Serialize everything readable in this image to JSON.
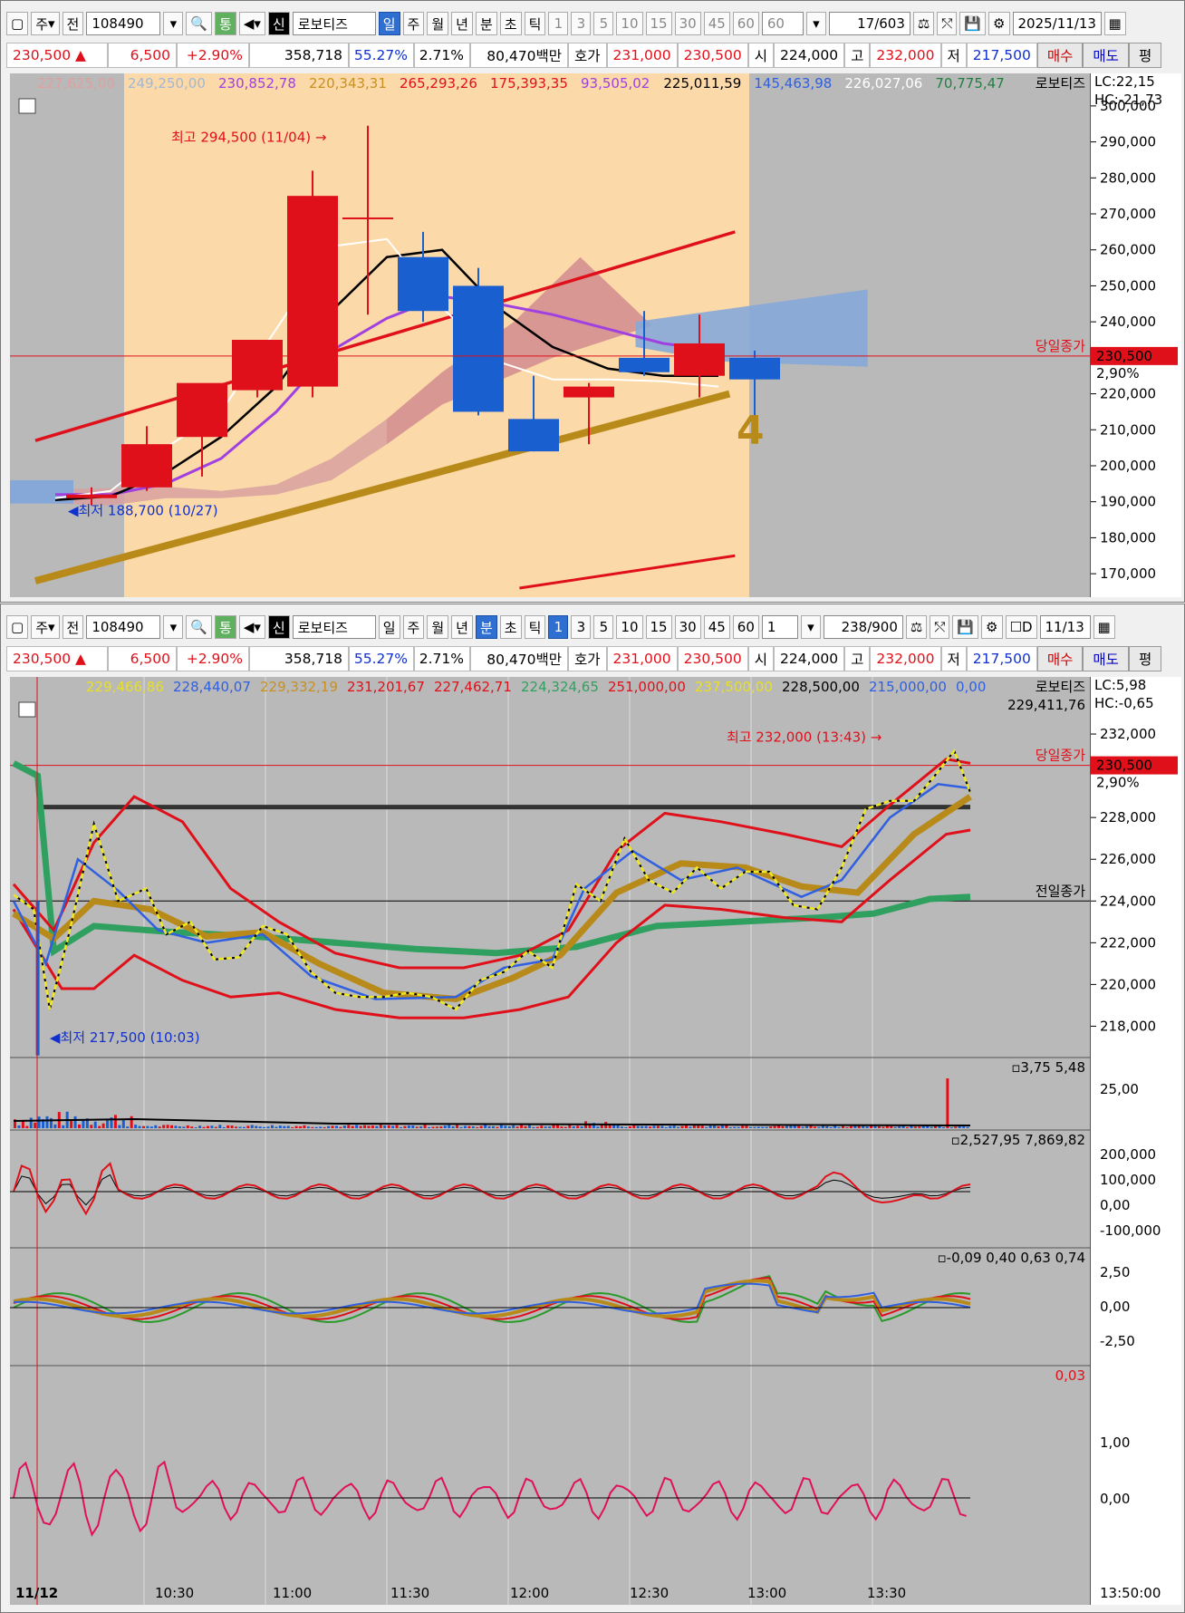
{
  "toolbar1": {
    "code": "108490",
    "name": "로보티즈",
    "btn_ju": "주",
    "btn_jeon": "전",
    "period_tabs": [
      "일",
      "주",
      "월",
      "년",
      "분",
      "초",
      "틱"
    ],
    "nums": [
      "1",
      "3",
      "5",
      "10",
      "15",
      "30",
      "45",
      "60",
      "60"
    ],
    "count": "17",
    "count_total": "/603",
    "date": "2025/11/13",
    "btn_tong": "통",
    "btn_sin": "신"
  },
  "toolbar2": {
    "code": "108490",
    "name": "로보티즈",
    "btn_ju": "주",
    "btn_jeon": "전",
    "period_tabs": [
      "일",
      "주",
      "월",
      "년",
      "분",
      "초",
      "틱"
    ],
    "nums": [
      "1",
      "3",
      "5",
      "10",
      "15",
      "30",
      "45",
      "60"
    ],
    "interval": "1",
    "count": "238",
    "count_total": "/900",
    "date": "11/13",
    "check_label": "D",
    "btn_tong": "통",
    "btn_sin": "신"
  },
  "quote": {
    "price": "230,500",
    "arrow": "▲",
    "change": "6,500",
    "pct": "+2.90%",
    "volume": "358,718",
    "ratio1": "55.27%",
    "ratio2": "2.71%",
    "amount": "80,470백만",
    "hoga_label": "호가",
    "ask": "231,000",
    "bid": "230,500",
    "open_label": "시",
    "open": "224,000",
    "high_label": "고",
    "high": "232,000",
    "low_label": "저",
    "low": "217,500",
    "buy": "매수",
    "sell": "매도",
    "eval": "평"
  },
  "colors": {
    "up": "#e0101a",
    "down": "#1a5fd0",
    "highlight": "#fcd9a8",
    "plot_bg": "#b9b9b9"
  },
  "chart_data": [
    {
      "type": "candlestick",
      "title": "daily",
      "legend_values": [
        "227,625,00",
        "249,250,00",
        "230,852,78",
        "220,343,31",
        "265,293,26",
        "175,393,35",
        "93,505,02",
        "225,011,59",
        "145,463,98",
        "226,027,06",
        "70,775,47"
      ],
      "legend_colors": [
        "#e0a0a0",
        "#a0b8d8",
        "#a040e0",
        "#c89020",
        "#e0101a",
        "#e0101a",
        "#a040e0",
        "#000000",
        "#3060e0",
        "#ffffff",
        "#208040"
      ],
      "legend_name": "로보티즈",
      "lc_label": "LC:22,15",
      "hc_label": "HC:-21,73",
      "ylim": [
        166000,
        304000
      ],
      "y_ticks": [
        "300,000",
        "290,000",
        "280,000",
        "270,000",
        "260,000",
        "250,000",
        "240,000",
        "230,000",
        "220,000",
        "210,000",
        "200,000",
        "190,000",
        "180,000",
        "170,000"
      ],
      "y_tick_values": [
        300000,
        290000,
        280000,
        270000,
        260000,
        250000,
        240000,
        230000,
        220000,
        210000,
        200000,
        190000,
        180000,
        170000
      ],
      "candles": [
        {
          "o": 191000,
          "h": 194000,
          "l": 189000,
          "c": 192000
        },
        {
          "o": 194000,
          "h": 211000,
          "l": 193000,
          "c": 206000
        },
        {
          "o": 208000,
          "h": 222000,
          "l": 197000,
          "c": 223000
        },
        {
          "o": 221000,
          "h": 234000,
          "l": 219000,
          "c": 235000
        },
        {
          "o": 222000,
          "h": 282000,
          "l": 219000,
          "c": 275000
        },
        {
          "o": 269000,
          "h": 294500,
          "l": 242000,
          "c": 269000
        },
        {
          "o": 258000,
          "h": 265000,
          "l": 240000,
          "c": 243000
        },
        {
          "o": 250000,
          "h": 255000,
          "l": 214000,
          "c": 215000
        },
        {
          "o": 213000,
          "h": 225000,
          "l": 204000,
          "c": 204000
        },
        {
          "o": 219000,
          "h": 223000,
          "l": 206000,
          "c": 222000
        },
        {
          "o": 230000,
          "h": 243000,
          "l": 225000,
          "c": 226000
        },
        {
          "o": 225000,
          "h": 242000,
          "l": 219000,
          "c": 234000
        },
        {
          "o": 230000,
          "h": 232000,
          "l": 213000,
          "c": 224000
        }
      ],
      "high_note": "최고 294,500 (11/04)",
      "low_note": "최저 188,700 (10/27)",
      "last_close_label": "당일종가",
      "last_price": "230,500",
      "last_pct": "2,90%",
      "wave_label": "4"
    },
    {
      "type": "line",
      "title": "1min",
      "legend_values": [
        "229,466,86",
        "228,440,07",
        "229,332,19",
        "231,201,67",
        "227,462,71",
        "224,324,65",
        "251,000,00",
        "237,500,00",
        "228,500,00",
        "215,000,00",
        "0,00"
      ],
      "legend_colors": [
        "#e8e020",
        "#3060e0",
        "#c89020",
        "#e0101a",
        "#e0101a",
        "#30a060",
        "#e0101a",
        "#e8e020",
        "#000000",
        "#3060e0",
        "#3060e0"
      ],
      "legend_extra": "229,411,76",
      "legend_name": "로보티즈",
      "lc_label": "LC:5,98",
      "hc_label": "HC:-0,65",
      "ylim": [
        216500,
        233000
      ],
      "y_ticks": [
        "232,000",
        "228,000",
        "226,000",
        "224,000",
        "222,000",
        "220,000",
        "218,000"
      ],
      "y_tick_values": [
        232000,
        228000,
        226000,
        224000,
        222000,
        220000,
        218000
      ],
      "x_ticks": [
        "11/12",
        "10:30",
        "11:00",
        "11:30",
        "12:00",
        "12:30",
        "13:00",
        "13:30",
        "13:50:00"
      ],
      "high_note": "최고 232,000 (13:43)",
      "low_note": "최저 217,500 (10:03)",
      "last_close_label": "당일종가",
      "prev_close_label": "전일종가",
      "prev_close": 224000,
      "last_price": "230,500",
      "last_pct": "2,90%",
      "price_points": [
        [
          0,
          224300
        ],
        [
          5,
          223600
        ],
        [
          9,
          218800
        ],
        [
          14,
          222600
        ],
        [
          20,
          227700
        ],
        [
          26,
          224000
        ],
        [
          33,
          224600
        ],
        [
          38,
          222400
        ],
        [
          44,
          223000
        ],
        [
          50,
          221200
        ],
        [
          56,
          221300
        ],
        [
          62,
          222800
        ],
        [
          68,
          222400
        ],
        [
          74,
          220600
        ],
        [
          80,
          219600
        ],
        [
          86,
          219400
        ],
        [
          92,
          219400
        ],
        [
          98,
          219600
        ],
        [
          104,
          219400
        ],
        [
          110,
          218800
        ],
        [
          116,
          220200
        ],
        [
          122,
          220600
        ],
        [
          128,
          221600
        ],
        [
          134,
          220800
        ],
        [
          140,
          224800
        ],
        [
          146,
          224000
        ],
        [
          152,
          227000
        ],
        [
          158,
          225000
        ],
        [
          164,
          224400
        ],
        [
          170,
          225600
        ],
        [
          176,
          224600
        ],
        [
          182,
          225400
        ],
        [
          188,
          225400
        ],
        [
          194,
          223800
        ],
        [
          200,
          223600
        ],
        [
          206,
          225600
        ],
        [
          212,
          228400
        ],
        [
          218,
          228800
        ],
        [
          224,
          228800
        ],
        [
          230,
          230200
        ],
        [
          234,
          231200
        ],
        [
          238,
          229200
        ]
      ],
      "ema_fast": [
        [
          0,
          224000
        ],
        [
          8,
          221000
        ],
        [
          16,
          226000
        ],
        [
          26,
          224500
        ],
        [
          36,
          222600
        ],
        [
          48,
          222000
        ],
        [
          62,
          222400
        ],
        [
          74,
          220400
        ],
        [
          90,
          219300
        ],
        [
          110,
          219400
        ],
        [
          122,
          220800
        ],
        [
          134,
          221200
        ],
        [
          142,
          224600
        ],
        [
          154,
          226400
        ],
        [
          166,
          225000
        ],
        [
          180,
          225600
        ],
        [
          196,
          224200
        ],
        [
          206,
          225000
        ],
        [
          218,
          228000
        ],
        [
          230,
          229600
        ],
        [
          238,
          229400
        ]
      ],
      "ema_slow": [
        [
          0,
          223400
        ],
        [
          10,
          222200
        ],
        [
          20,
          224000
        ],
        [
          34,
          223600
        ],
        [
          48,
          222300
        ],
        [
          62,
          222500
        ],
        [
          76,
          221000
        ],
        [
          92,
          219600
        ],
        [
          110,
          219300
        ],
        [
          124,
          220300
        ],
        [
          136,
          221400
        ],
        [
          150,
          224400
        ],
        [
          166,
          225800
        ],
        [
          182,
          225600
        ],
        [
          196,
          224700
        ],
        [
          210,
          224400
        ],
        [
          224,
          227200
        ],
        [
          238,
          229000
        ]
      ],
      "ma_long": [
        [
          0,
          230600
        ],
        [
          6,
          230000
        ],
        [
          10,
          221600
        ],
        [
          20,
          222800
        ],
        [
          40,
          222500
        ],
        [
          60,
          222300
        ],
        [
          80,
          222000
        ],
        [
          100,
          221700
        ],
        [
          120,
          221500
        ],
        [
          140,
          221800
        ],
        [
          160,
          222800
        ],
        [
          180,
          223000
        ],
        [
          200,
          223200
        ],
        [
          214,
          223400
        ],
        [
          222,
          223800
        ],
        [
          228,
          224100
        ],
        [
          238,
          224200
        ]
      ],
      "band_upper": [
        [
          0,
          224800
        ],
        [
          10,
          222600
        ],
        [
          20,
          226800
        ],
        [
          30,
          229000
        ],
        [
          42,
          227800
        ],
        [
          54,
          224600
        ],
        [
          66,
          223000
        ],
        [
          80,
          221500
        ],
        [
          96,
          220800
        ],
        [
          112,
          220800
        ],
        [
          126,
          221400
        ],
        [
          138,
          222600
        ],
        [
          150,
          226400
        ],
        [
          162,
          228200
        ],
        [
          176,
          227800
        ],
        [
          192,
          227200
        ],
        [
          206,
          226600
        ],
        [
          218,
          228600
        ],
        [
          232,
          230800
        ],
        [
          238,
          230600
        ]
      ],
      "band_lower": [
        [
          0,
          223600
        ],
        [
          12,
          219800
        ],
        [
          20,
          219800
        ],
        [
          30,
          221400
        ],
        [
          42,
          220200
        ],
        [
          54,
          219400
        ],
        [
          66,
          219600
        ],
        [
          80,
          218800
        ],
        [
          96,
          218400
        ],
        [
          112,
          218400
        ],
        [
          126,
          218800
        ],
        [
          138,
          219400
        ],
        [
          150,
          222000
        ],
        [
          162,
          223800
        ],
        [
          176,
          223600
        ],
        [
          192,
          223200
        ],
        [
          206,
          223000
        ],
        [
          218,
          225000
        ],
        [
          232,
          227200
        ],
        [
          238,
          227400
        ]
      ],
      "level_line": 228500,
      "volume": {
        "labels": [
          "3,75",
          "5,48"
        ],
        "tick": "25,00"
      },
      "macd": {
        "labels": [
          "2,527,95",
          "7,869,82"
        ],
        "ticks": [
          "200,000",
          "100,000",
          "0,00",
          "-100,000"
        ]
      },
      "stoch": {
        "labels": [
          "-0,09",
          "0,40",
          "0,63",
          "0,74"
        ],
        "ticks": [
          "2,50",
          "0,00",
          "-2,50"
        ]
      },
      "osc": {
        "labels": [
          "0,03"
        ],
        "ticks": [
          "1,00",
          "0,00"
        ]
      }
    }
  ]
}
